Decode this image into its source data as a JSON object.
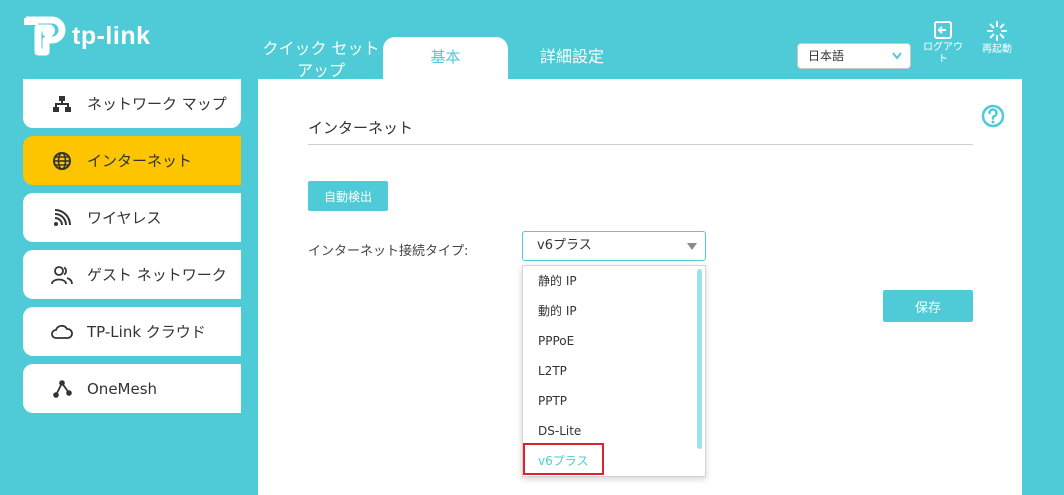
{
  "header": {
    "brand": "tp-link",
    "tabs": [
      {
        "label": "クイック セット\nアップ"
      },
      {
        "label": "基本"
      },
      {
        "label": "詳細設定"
      }
    ],
    "language": "日本語",
    "logout": "ログアウ\nト",
    "reboot": "再起動"
  },
  "sidebar": {
    "items": [
      {
        "label": "ネットワーク マップ",
        "icon": "network-map-icon"
      },
      {
        "label": "インターネット",
        "icon": "globe-icon"
      },
      {
        "label": "ワイヤレス",
        "icon": "wireless-icon"
      },
      {
        "label": "ゲスト ネットワーク",
        "icon": "guest-users-icon"
      },
      {
        "label": "TP-Link クラウド",
        "icon": "cloud-icon"
      },
      {
        "label": "OneMesh",
        "icon": "mesh-icon"
      }
    ]
  },
  "main": {
    "title": "インターネット",
    "auto_detect": "自動検出",
    "connection_label": "インターネット接続タイプ:",
    "connection_value": "v6プラス",
    "options": [
      "静的 IP",
      "動的 IP",
      "PPPoE",
      "L2TP",
      "PPTP",
      "DS-Lite",
      "v6プラス"
    ],
    "save": "保存"
  },
  "colors": {
    "accent": "#4ecbd6",
    "active_nav": "#fcc500",
    "highlight": "#d9232e"
  }
}
